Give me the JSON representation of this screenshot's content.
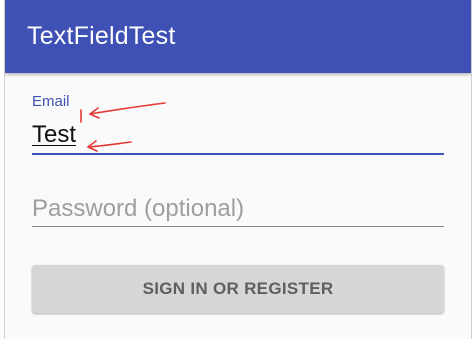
{
  "colors": {
    "app_bar": "#3f51b5",
    "accent": "#3f51b5",
    "button_bg": "#d6d6d6",
    "annotation": "#e53935"
  },
  "appbar": {
    "title": "TextFieldTest"
  },
  "form": {
    "email": {
      "label": "Email",
      "value": "Test"
    },
    "password": {
      "placeholder": "Password (optional)"
    },
    "submit_label": "SIGN IN OR REGISTER"
  },
  "annotations": {
    "arrows": [
      "red-arrow-icon",
      "red-arrow-icon"
    ]
  }
}
